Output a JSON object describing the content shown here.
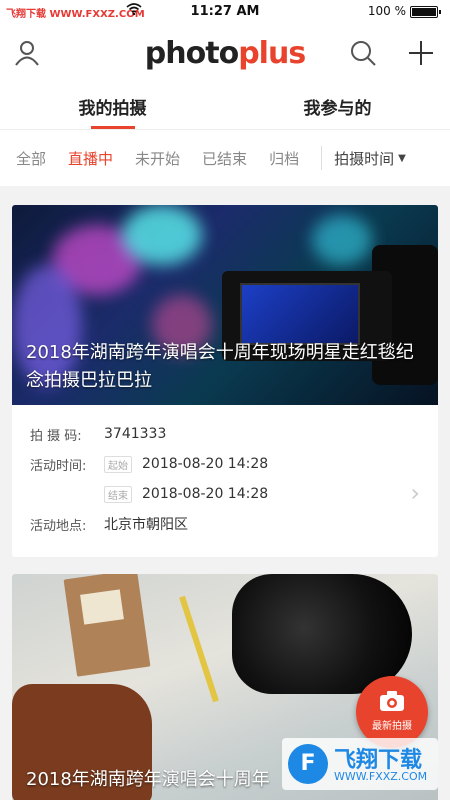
{
  "status_bar": {
    "carrier": "飞翔下载 WWW.FXXZ.COM",
    "time": "11:27 AM",
    "battery": "100 %"
  },
  "header": {
    "logo_photo": "photo",
    "logo_plus": "plus"
  },
  "main_tabs": [
    {
      "label": "我的拍摄",
      "active": true
    },
    {
      "label": "我参与的",
      "active": false
    }
  ],
  "filters": [
    {
      "label": "全部",
      "active": false
    },
    {
      "label": "直播中",
      "active": true
    },
    {
      "label": "未开始",
      "active": false
    },
    {
      "label": "已结束",
      "active": false
    },
    {
      "label": "归档",
      "active": false
    }
  ],
  "sort": {
    "label": "拍摄时间"
  },
  "cards": [
    {
      "title": "2018年湖南跨年演唱会十周年现场明星走红毯纪念拍摄巴拉巴拉",
      "code_label": "拍 摄 码:",
      "code": "3741333",
      "time_label": "活动时间:",
      "start_tag": "起始",
      "start": "2018-08-20  14:28",
      "end_tag": "结束",
      "end": "2018-08-20  14:28",
      "location_label": "活动地点:",
      "location": "北京市朝阳区"
    },
    {
      "title": "2018年湖南跨年演唱会十周年"
    }
  ],
  "fab": {
    "label": "最新拍摄"
  },
  "watermark": {
    "title": "飞翔下载",
    "url": "WWW.FXXZ.COM",
    "icon": "F"
  },
  "colors": {
    "accent": "#e8432c"
  }
}
